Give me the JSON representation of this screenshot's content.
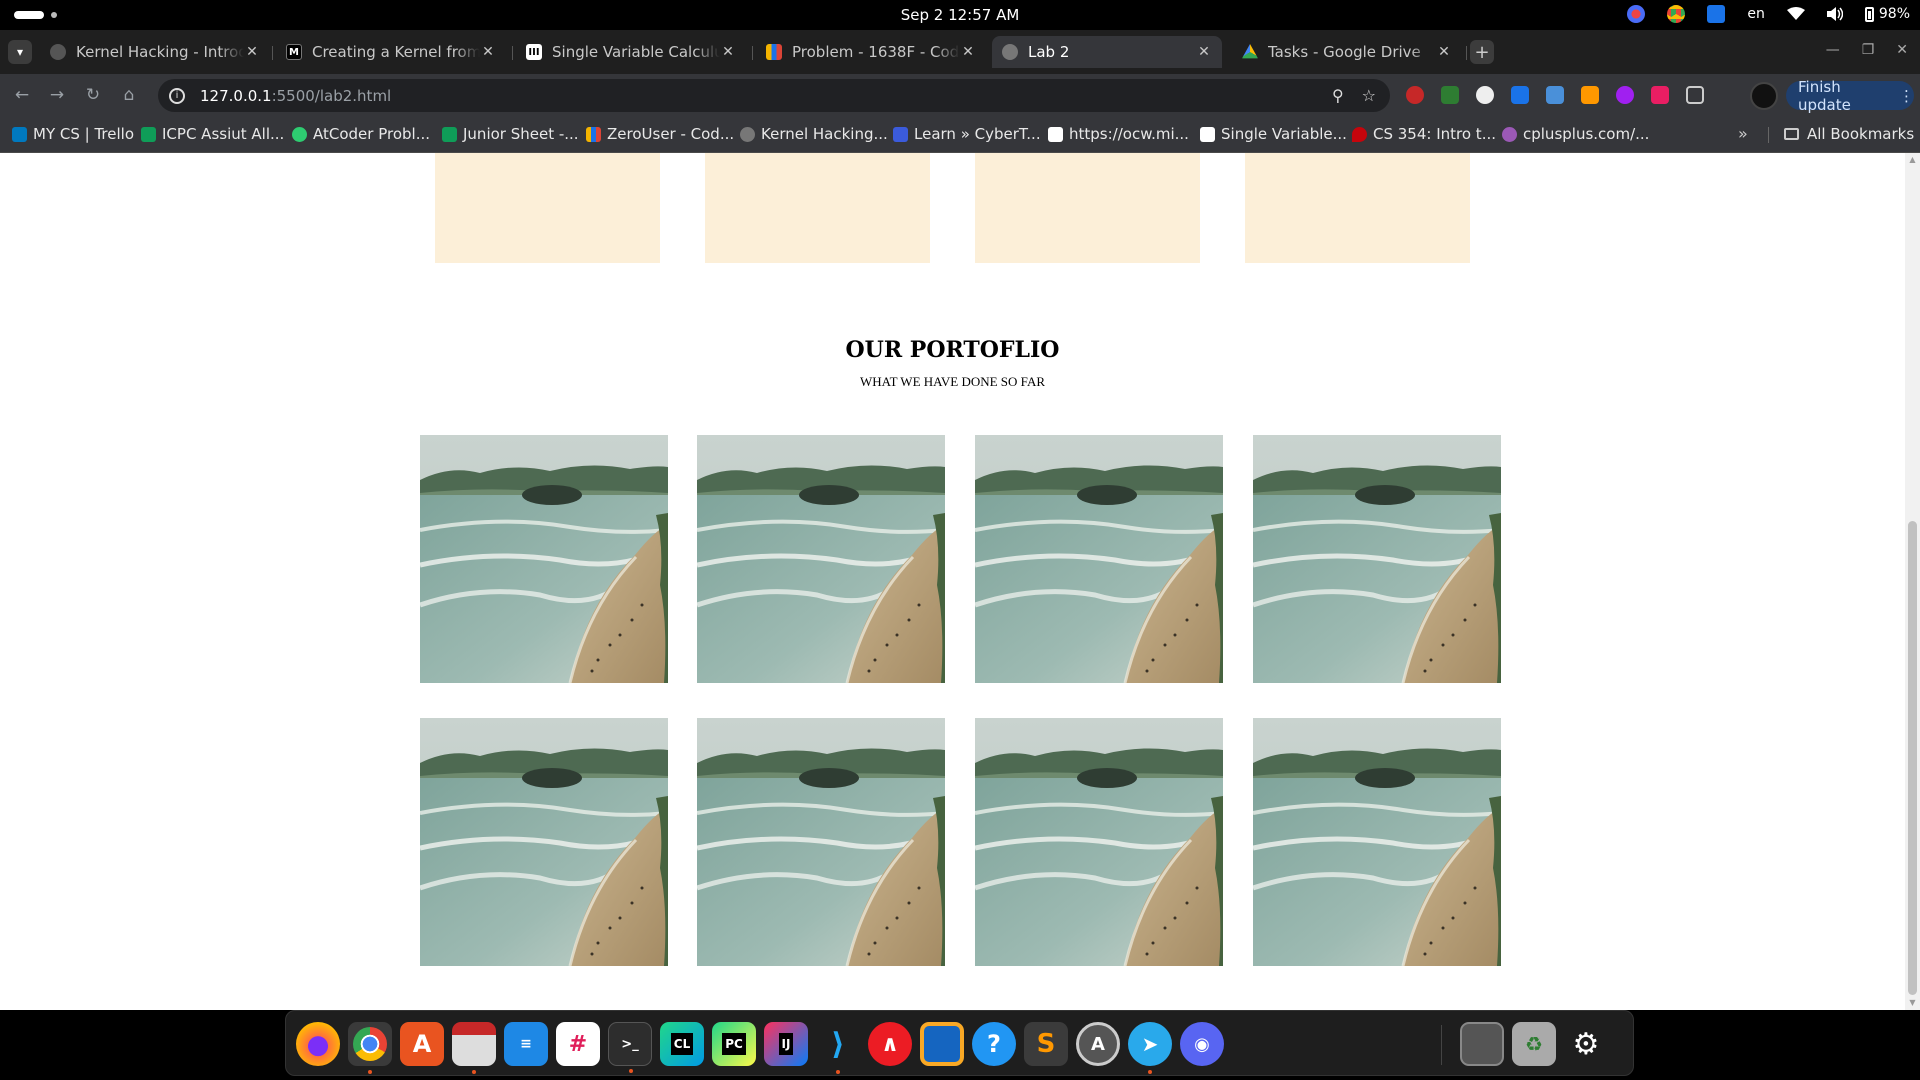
{
  "system": {
    "clock": "Sep 2  12:57 AM",
    "language": "en",
    "battery": "98%"
  },
  "browser": {
    "tabs": [
      {
        "title": "Kernel Hacking - Introdu",
        "favicon": "globe-icon",
        "active": false
      },
      {
        "title": "Creating a Kernel from S",
        "favicon": "medium-icon",
        "active": false
      },
      {
        "title": "Single Variable Calculus |",
        "favicon": "mit-icon",
        "active": false
      },
      {
        "title": "Problem - 1638F - Codefo",
        "favicon": "codeforces-icon",
        "active": false
      },
      {
        "title": "Lab 2",
        "favicon": "globe-icon",
        "active": true
      },
      {
        "title": "Tasks - Google Drive",
        "favicon": "drive-icon",
        "active": false
      }
    ],
    "url_host": "127.0.0.1",
    "url_rest": ":5500/lab2.html",
    "finish_update": "Finish update",
    "bookmarks": [
      {
        "label": "MY CS | Trello",
        "color": "#0079bf"
      },
      {
        "label": "ICPC Assiut All...",
        "color": "#0f9d58"
      },
      {
        "label": "AtCoder Probl...",
        "color": "#2ecc71"
      },
      {
        "label": "Junior Sheet -...",
        "color": "#0f9d58"
      },
      {
        "label": "ZeroUser - Cod...",
        "color": "#f4b400"
      },
      {
        "label": "Kernel Hacking...",
        "color": "#777777"
      },
      {
        "label": "Learn » CyberT...",
        "color": "#3b5bdb"
      },
      {
        "label": "https://ocw.mi...",
        "color": "#111111"
      },
      {
        "label": "Single Variable...",
        "color": "#111111"
      },
      {
        "label": "CS 354: Intro t...",
        "color": "#c5050c"
      },
      {
        "label": "cplusplus.com/...",
        "color": "#9b59b6"
      }
    ],
    "all_bookmarks": "All Bookmarks"
  },
  "page": {
    "portfolio_title": "OUR PORTOFLIO",
    "portfolio_subtitle": "WHAT WE HAVE DONE SO FAR",
    "feature_box_color": "#fcefd8",
    "photo_count": 8
  },
  "dock": {
    "apps": [
      "firefox-icon",
      "chrome-icon",
      "app-center-icon",
      "files-icon",
      "text-editor-icon",
      "slack-icon",
      "terminal-icon",
      "clion-icon",
      "pycharm-icon",
      "intellij-icon",
      "vscode-icon",
      "authy-icon",
      "virtualbox-icon",
      "help-icon",
      "sublime-icon",
      "software-updater-icon",
      "telegram-icon",
      "discord-icon",
      "disk-icon",
      "trash-icon",
      "ubuntu-icon"
    ]
  }
}
